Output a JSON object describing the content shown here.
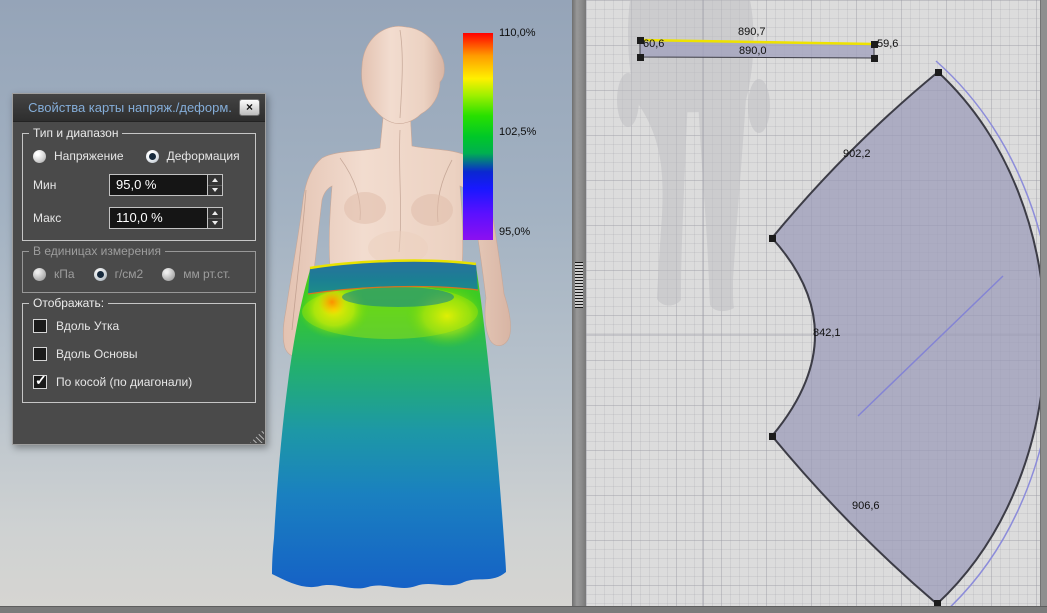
{
  "icons": {
    "close": "×",
    "check": "✓"
  },
  "dialog": {
    "title": "Свойства карты напряж./деформ.",
    "type_range": {
      "legend": "Тип и диапазон",
      "options": [
        {
          "label": "Напряжение",
          "selected": false
        },
        {
          "label": "Деформация",
          "selected": true
        }
      ],
      "min": {
        "label": "Мин",
        "value": "95,0 %"
      },
      "max": {
        "label": "Макс",
        "value": "110,0 %"
      }
    },
    "units": {
      "legend": "В единицах измерения",
      "disabled": true,
      "options": [
        {
          "label": "кПа",
          "selected": false
        },
        {
          "label": "г/см2",
          "selected": true
        },
        {
          "label": "мм рт.ст.",
          "selected": false
        }
      ]
    },
    "display": {
      "legend": "Отображать:",
      "options": [
        {
          "label": "Вдоль Утка",
          "checked": false
        },
        {
          "label": "Вдоль Основы",
          "checked": false
        },
        {
          "label": "По косой (по диагонали)",
          "checked": true
        }
      ]
    }
  },
  "colorbar": {
    "labels": {
      "max": "110,0%",
      "mid": "102,5%",
      "min": "95,0%"
    },
    "scale_colors": [
      "#ff0000",
      "#ffff00",
      "#00c828",
      "#1818ff",
      "#8c10f0"
    ]
  },
  "pattern_view": {
    "waistband": {
      "top_length": "890,7",
      "bottom_length": "890,0",
      "left_height": "60,6",
      "right_height": "59,6"
    },
    "skirt_panel": {
      "top_edge": "902,2",
      "waist_edge": "842,1",
      "bottom_edge": "906,6"
    }
  },
  "colors": {
    "selection_yellow": "#f2e600",
    "seam_allowance_purple": "#8c8cda",
    "piece_fill": "#a0a0bc"
  }
}
